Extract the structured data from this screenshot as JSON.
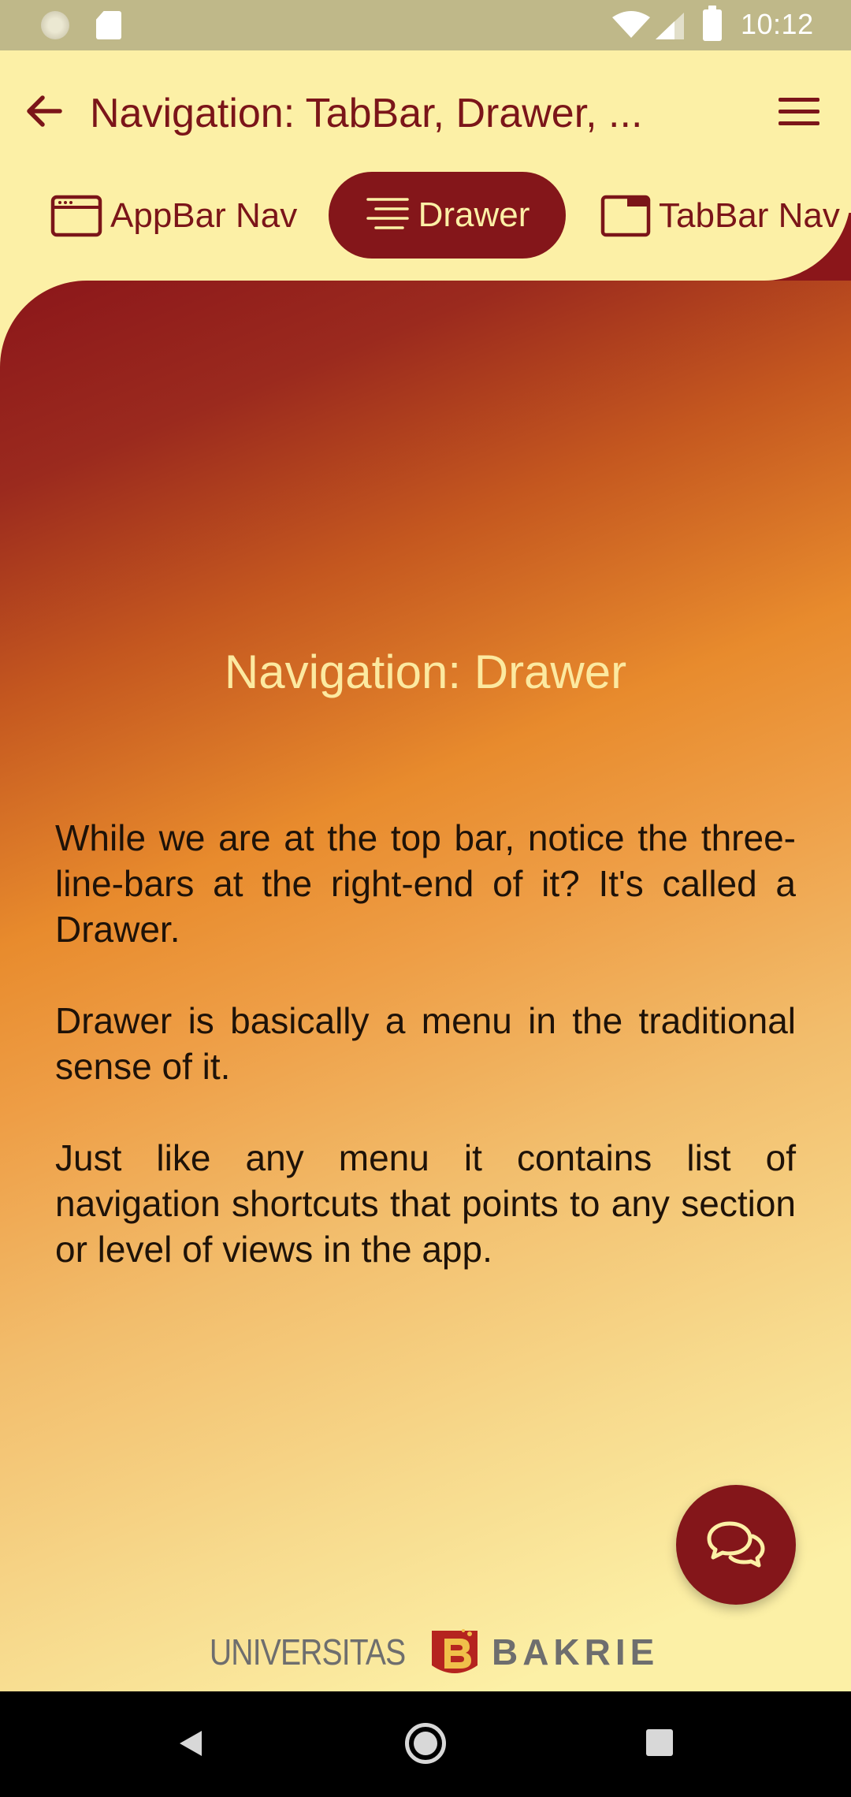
{
  "status_bar": {
    "time": "10:12",
    "icons": [
      "sync-icon",
      "sd-card-icon",
      "wifi-icon",
      "signal-icon",
      "battery-icon"
    ]
  },
  "app_bar": {
    "title": "Navigation: TabBar, Drawer, ...",
    "back_icon": "arrow-left-icon",
    "menu_icon": "hamburger-menu-icon"
  },
  "tabs": [
    {
      "label": "AppBar Nav",
      "icon": "browser-window-icon",
      "selected": false
    },
    {
      "label": "Drawer",
      "icon": "drawer-lines-icon",
      "selected": true
    },
    {
      "label": "TabBar Nav",
      "icon": "tab-window-icon",
      "selected": false
    }
  ],
  "content": {
    "heading": "Navigation: Drawer",
    "paragraphs": [
      "While we are at the top bar, notice the three-line-bars at the right-end of it? It's called a Drawer.",
      "Drawer is basically a menu in the traditional sense of it.",
      "Just like any menu it contains list of navigation shortcuts that points to any section or level of views in the app."
    ]
  },
  "fab": {
    "icon": "chat-bubbles-icon"
  },
  "footer": {
    "logo_left": "UNIVERSITAS",
    "logo_right": "BAKRIE"
  },
  "colors": {
    "background": "#FCF0A6",
    "brand": "#84161A",
    "accent_orange": "#EE9E46",
    "status_bar": "#BFB889"
  }
}
